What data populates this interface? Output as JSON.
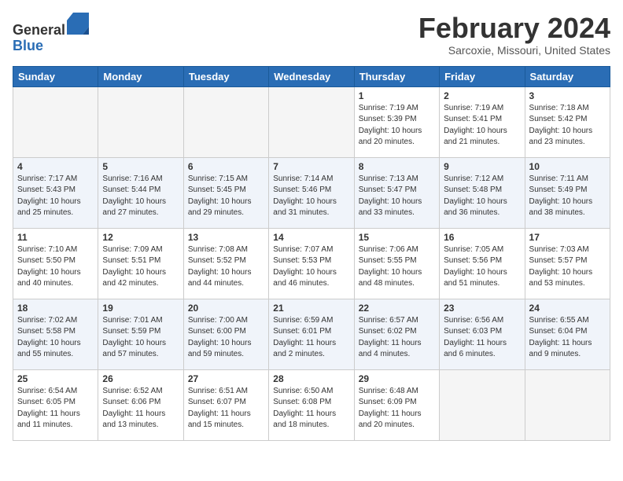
{
  "header": {
    "logo_general": "General",
    "logo_blue": "Blue",
    "month_title": "February 2024",
    "location": "Sarcoxie, Missouri, United States"
  },
  "weekdays": [
    "Sunday",
    "Monday",
    "Tuesday",
    "Wednesday",
    "Thursday",
    "Friday",
    "Saturday"
  ],
  "weeks": [
    [
      {
        "day": "",
        "info": ""
      },
      {
        "day": "",
        "info": ""
      },
      {
        "day": "",
        "info": ""
      },
      {
        "day": "",
        "info": ""
      },
      {
        "day": "1",
        "info": "Sunrise: 7:19 AM\nSunset: 5:39 PM\nDaylight: 10 hours\nand 20 minutes."
      },
      {
        "day": "2",
        "info": "Sunrise: 7:19 AM\nSunset: 5:41 PM\nDaylight: 10 hours\nand 21 minutes."
      },
      {
        "day": "3",
        "info": "Sunrise: 7:18 AM\nSunset: 5:42 PM\nDaylight: 10 hours\nand 23 minutes."
      }
    ],
    [
      {
        "day": "4",
        "info": "Sunrise: 7:17 AM\nSunset: 5:43 PM\nDaylight: 10 hours\nand 25 minutes."
      },
      {
        "day": "5",
        "info": "Sunrise: 7:16 AM\nSunset: 5:44 PM\nDaylight: 10 hours\nand 27 minutes."
      },
      {
        "day": "6",
        "info": "Sunrise: 7:15 AM\nSunset: 5:45 PM\nDaylight: 10 hours\nand 29 minutes."
      },
      {
        "day": "7",
        "info": "Sunrise: 7:14 AM\nSunset: 5:46 PM\nDaylight: 10 hours\nand 31 minutes."
      },
      {
        "day": "8",
        "info": "Sunrise: 7:13 AM\nSunset: 5:47 PM\nDaylight: 10 hours\nand 33 minutes."
      },
      {
        "day": "9",
        "info": "Sunrise: 7:12 AM\nSunset: 5:48 PM\nDaylight: 10 hours\nand 36 minutes."
      },
      {
        "day": "10",
        "info": "Sunrise: 7:11 AM\nSunset: 5:49 PM\nDaylight: 10 hours\nand 38 minutes."
      }
    ],
    [
      {
        "day": "11",
        "info": "Sunrise: 7:10 AM\nSunset: 5:50 PM\nDaylight: 10 hours\nand 40 minutes."
      },
      {
        "day": "12",
        "info": "Sunrise: 7:09 AM\nSunset: 5:51 PM\nDaylight: 10 hours\nand 42 minutes."
      },
      {
        "day": "13",
        "info": "Sunrise: 7:08 AM\nSunset: 5:52 PM\nDaylight: 10 hours\nand 44 minutes."
      },
      {
        "day": "14",
        "info": "Sunrise: 7:07 AM\nSunset: 5:53 PM\nDaylight: 10 hours\nand 46 minutes."
      },
      {
        "day": "15",
        "info": "Sunrise: 7:06 AM\nSunset: 5:55 PM\nDaylight: 10 hours\nand 48 minutes."
      },
      {
        "day": "16",
        "info": "Sunrise: 7:05 AM\nSunset: 5:56 PM\nDaylight: 10 hours\nand 51 minutes."
      },
      {
        "day": "17",
        "info": "Sunrise: 7:03 AM\nSunset: 5:57 PM\nDaylight: 10 hours\nand 53 minutes."
      }
    ],
    [
      {
        "day": "18",
        "info": "Sunrise: 7:02 AM\nSunset: 5:58 PM\nDaylight: 10 hours\nand 55 minutes."
      },
      {
        "day": "19",
        "info": "Sunrise: 7:01 AM\nSunset: 5:59 PM\nDaylight: 10 hours\nand 57 minutes."
      },
      {
        "day": "20",
        "info": "Sunrise: 7:00 AM\nSunset: 6:00 PM\nDaylight: 10 hours\nand 59 minutes."
      },
      {
        "day": "21",
        "info": "Sunrise: 6:59 AM\nSunset: 6:01 PM\nDaylight: 11 hours\nand 2 minutes."
      },
      {
        "day": "22",
        "info": "Sunrise: 6:57 AM\nSunset: 6:02 PM\nDaylight: 11 hours\nand 4 minutes."
      },
      {
        "day": "23",
        "info": "Sunrise: 6:56 AM\nSunset: 6:03 PM\nDaylight: 11 hours\nand 6 minutes."
      },
      {
        "day": "24",
        "info": "Sunrise: 6:55 AM\nSunset: 6:04 PM\nDaylight: 11 hours\nand 9 minutes."
      }
    ],
    [
      {
        "day": "25",
        "info": "Sunrise: 6:54 AM\nSunset: 6:05 PM\nDaylight: 11 hours\nand 11 minutes."
      },
      {
        "day": "26",
        "info": "Sunrise: 6:52 AM\nSunset: 6:06 PM\nDaylight: 11 hours\nand 13 minutes."
      },
      {
        "day": "27",
        "info": "Sunrise: 6:51 AM\nSunset: 6:07 PM\nDaylight: 11 hours\nand 15 minutes."
      },
      {
        "day": "28",
        "info": "Sunrise: 6:50 AM\nSunset: 6:08 PM\nDaylight: 11 hours\nand 18 minutes."
      },
      {
        "day": "29",
        "info": "Sunrise: 6:48 AM\nSunset: 6:09 PM\nDaylight: 11 hours\nand 20 minutes."
      },
      {
        "day": "",
        "info": ""
      },
      {
        "day": "",
        "info": ""
      }
    ]
  ]
}
